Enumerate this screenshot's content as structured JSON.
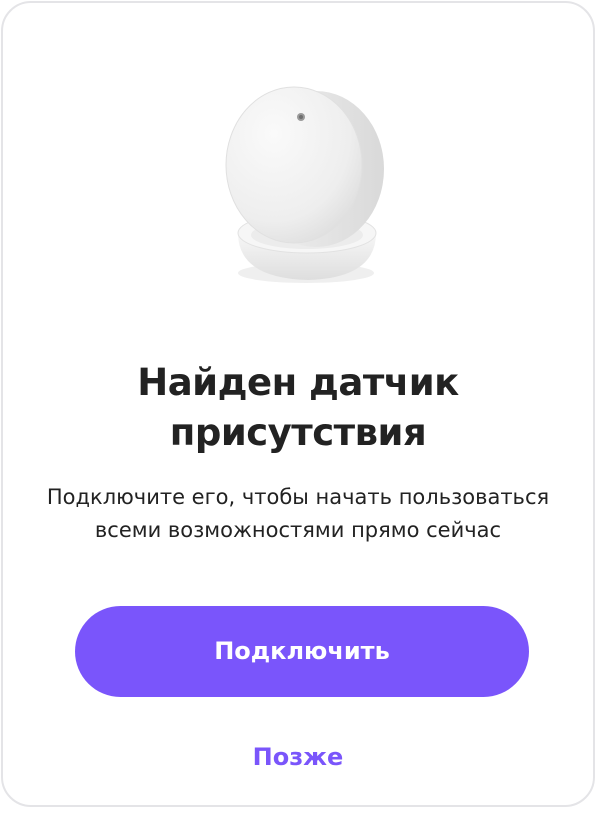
{
  "dialog": {
    "image": "presence-sensor-device",
    "title_line1": "Найден датчик",
    "title_line2": "присутствия",
    "subtitle_line1": "Подключите его, чтобы начать пользоваться",
    "subtitle_line2": "всеми возможностями прямо сейчас",
    "connect_label": "Подключить",
    "later_label": "Позже"
  },
  "colors": {
    "accent": "#7a55fb",
    "text": "#222222",
    "border": "#e4e4e7",
    "background": "#ffffff"
  }
}
